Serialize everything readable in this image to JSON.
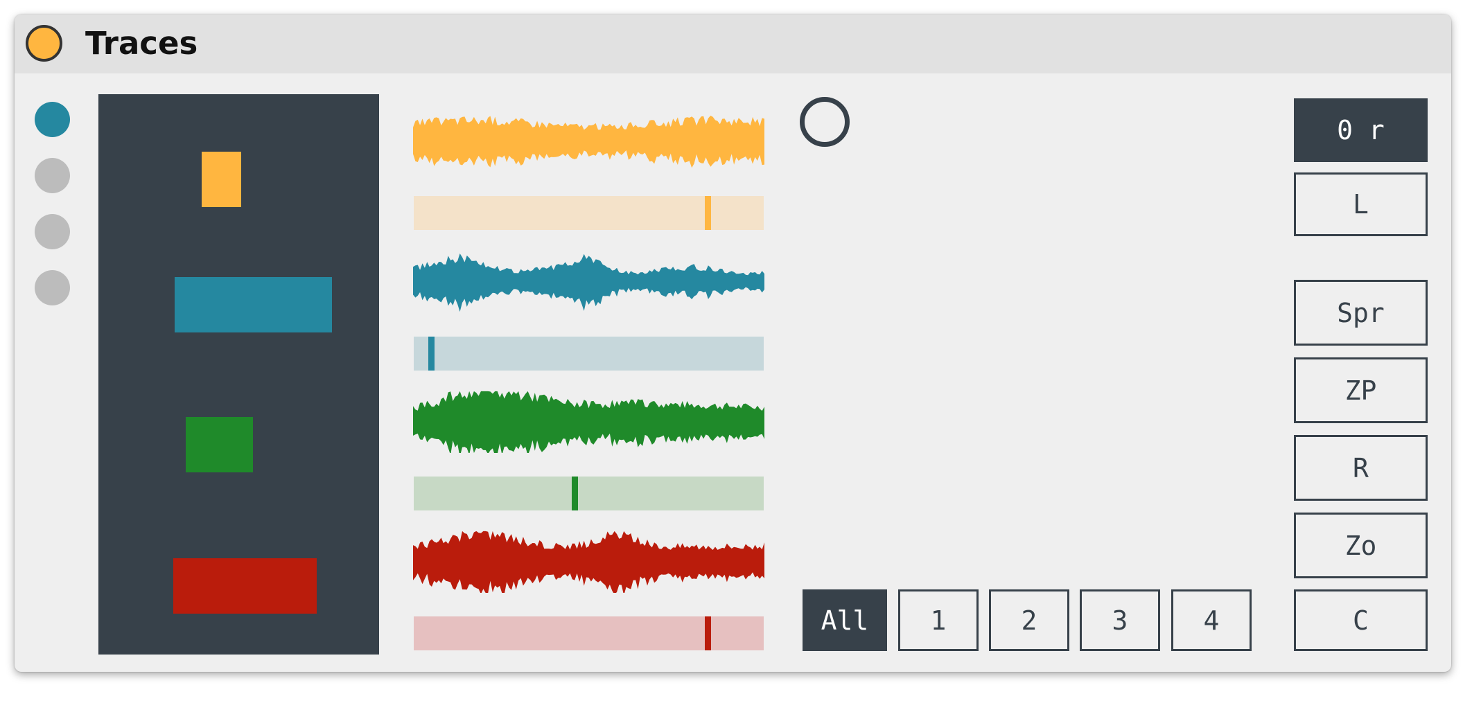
{
  "device": {
    "title": "Traces",
    "power_color": "#ffb640"
  },
  "selector_dots": [
    {
      "color": "#2588a0",
      "active": true
    },
    {
      "color": "#bcbcbc",
      "active": false
    },
    {
      "color": "#bcbcbc",
      "active": false
    },
    {
      "color": "#bcbcbc",
      "active": false
    }
  ],
  "traces": [
    {
      "color": "#ffb640",
      "slider_bg": "#f4e2c9",
      "position": 0.84
    },
    {
      "color": "#2588a0",
      "slider_bg": "#c6d7db",
      "position": 0.05
    },
    {
      "color": "#1f8a2a",
      "slider_bg": "#c7d9c5",
      "position": 0.46
    },
    {
      "color": "#ba1c0c",
      "slider_bg": "#e6c0c0",
      "position": 0.84
    }
  ],
  "mode_buttons": [
    {
      "label": "All",
      "active": true
    },
    {
      "label": "1",
      "active": false
    },
    {
      "label": "2",
      "active": false
    },
    {
      "label": "3",
      "active": false
    },
    {
      "label": "4",
      "active": false
    }
  ],
  "side_buttons": [
    {
      "label": "0 r",
      "active": true
    },
    {
      "label": "L",
      "active": false
    },
    {
      "label": "Spr",
      "active": false
    },
    {
      "label": "ZP",
      "active": false
    },
    {
      "label": "R",
      "active": false
    },
    {
      "label": "Zo",
      "active": false
    },
    {
      "label": "C",
      "active": false
    }
  ]
}
